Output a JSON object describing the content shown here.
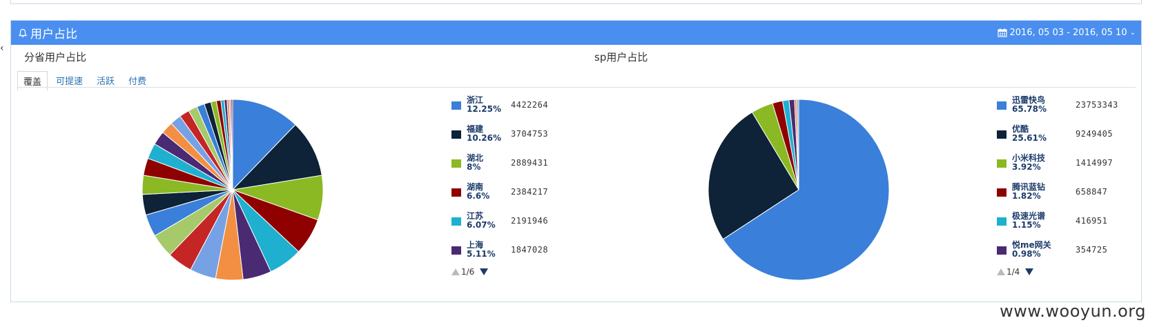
{
  "panel": {
    "title": "用户占比",
    "date_range": "2016, 05 03 - 2016, 05 10",
    "icon": "bell-icon",
    "header_color": "#4a8ff0"
  },
  "province_section": {
    "title": "分省用户占比",
    "tabs": [
      {
        "label": "覆盖",
        "active": true
      },
      {
        "label": "可提速",
        "active": false
      },
      {
        "label": "活跃",
        "active": false
      },
      {
        "label": "付费",
        "active": false
      }
    ],
    "legend": [
      {
        "name": "浙江",
        "pct": "12.25%",
        "value": "4422264",
        "color": "#3a7fd9"
      },
      {
        "name": "福建",
        "pct": "10.26%",
        "value": "3704753",
        "color": "#0e2238"
      },
      {
        "name": "湖北",
        "pct": "8%",
        "value": "2889431",
        "color": "#8ab923"
      },
      {
        "name": "湖南",
        "pct": "6.6%",
        "value": "2384217",
        "color": "#8f0000"
      },
      {
        "name": "江苏",
        "pct": "6.07%",
        "value": "2191946",
        "color": "#1fb0d0"
      },
      {
        "name": "上海",
        "pct": "5.11%",
        "value": "1847028",
        "color": "#4a2a72"
      }
    ],
    "pager": "1/6"
  },
  "sp_section": {
    "title": "sp用户占比",
    "legend": [
      {
        "name": "迅雷快鸟",
        "pct": "65.78%",
        "value": "23753343",
        "color": "#3a7fd9"
      },
      {
        "name": "优酷",
        "pct": "25.61%",
        "value": "9249405",
        "color": "#0e2238"
      },
      {
        "name": "小米科技",
        "pct": "3.92%",
        "value": "1414997",
        "color": "#8ab923"
      },
      {
        "name": "腾讯蓝钻",
        "pct": "1.82%",
        "value": "658847",
        "color": "#8f0000"
      },
      {
        "name": "极速光谱",
        "pct": "1.15%",
        "value": "416951",
        "color": "#1fb0d0"
      },
      {
        "name": "悦me网关",
        "pct": "0.98%",
        "value": "354725",
        "color": "#4a2a72"
      }
    ],
    "pager": "1/4"
  },
  "chart_data": [
    {
      "type": "pie",
      "title": "分省用户占比",
      "slices": [
        {
          "label": "浙江",
          "value": 12.25,
          "color": "#3a7fd9"
        },
        {
          "label": "福建",
          "value": 10.26,
          "color": "#0e2238"
        },
        {
          "label": "湖北",
          "value": 8.0,
          "color": "#8ab923"
        },
        {
          "label": "湖南",
          "value": 6.6,
          "color": "#8f0000"
        },
        {
          "label": "江苏",
          "value": 6.07,
          "color": "#1fb0d0"
        },
        {
          "label": "上海",
          "value": 5.11,
          "color": "#4a2a72"
        },
        {
          "label": "",
          "value": 4.9,
          "color": "#f28f43"
        },
        {
          "label": "",
          "value": 4.7,
          "color": "#77a1e5"
        },
        {
          "label": "",
          "value": 4.5,
          "color": "#c42525"
        },
        {
          "label": "",
          "value": 4.3,
          "color": "#a6c96a"
        },
        {
          "label": "",
          "value": 4.0,
          "color": "#3a7fd9"
        },
        {
          "label": "",
          "value": 3.7,
          "color": "#0e2238"
        },
        {
          "label": "",
          "value": 3.4,
          "color": "#8ab923"
        },
        {
          "label": "",
          "value": 3.1,
          "color": "#8f0000"
        },
        {
          "label": "",
          "value": 2.8,
          "color": "#1fb0d0"
        },
        {
          "label": "",
          "value": 2.5,
          "color": "#4a2a72"
        },
        {
          "label": "",
          "value": 2.2,
          "color": "#f28f43"
        },
        {
          "label": "",
          "value": 2.0,
          "color": "#77a1e5"
        },
        {
          "label": "",
          "value": 1.8,
          "color": "#c42525"
        },
        {
          "label": "",
          "value": 1.6,
          "color": "#a6c96a"
        },
        {
          "label": "",
          "value": 1.4,
          "color": "#3a7fd9"
        },
        {
          "label": "",
          "value": 1.2,
          "color": "#0e2238"
        },
        {
          "label": "",
          "value": 1.0,
          "color": "#8ab923"
        },
        {
          "label": "",
          "value": 0.8,
          "color": "#8f0000"
        },
        {
          "label": "",
          "value": 0.6,
          "color": "#1fb0d0"
        },
        {
          "label": "",
          "value": 0.5,
          "color": "#4a2a72"
        },
        {
          "label": "",
          "value": 0.4,
          "color": "#f28f43"
        },
        {
          "label": "",
          "value": 0.3,
          "color": "#77a1e5"
        },
        {
          "label": "",
          "value": 0.3,
          "color": "#c42525"
        }
      ]
    },
    {
      "type": "pie",
      "title": "sp用户占比",
      "slices": [
        {
          "label": "迅雷快鸟",
          "value": 65.78,
          "color": "#3a7fd9"
        },
        {
          "label": "优酷",
          "value": 25.61,
          "color": "#0e2238"
        },
        {
          "label": "小米科技",
          "value": 3.92,
          "color": "#8ab923"
        },
        {
          "label": "腾讯蓝钻",
          "value": 1.82,
          "color": "#8f0000"
        },
        {
          "label": "极速光谱",
          "value": 1.15,
          "color": "#1fb0d0"
        },
        {
          "label": "悦me网关",
          "value": 0.98,
          "color": "#4a2a72"
        },
        {
          "label": "",
          "value": 0.4,
          "color": "#f28f43"
        },
        {
          "label": "",
          "value": 0.34,
          "color": "#77a1e5"
        }
      ]
    }
  ],
  "watermark": "www.wooyun.org"
}
